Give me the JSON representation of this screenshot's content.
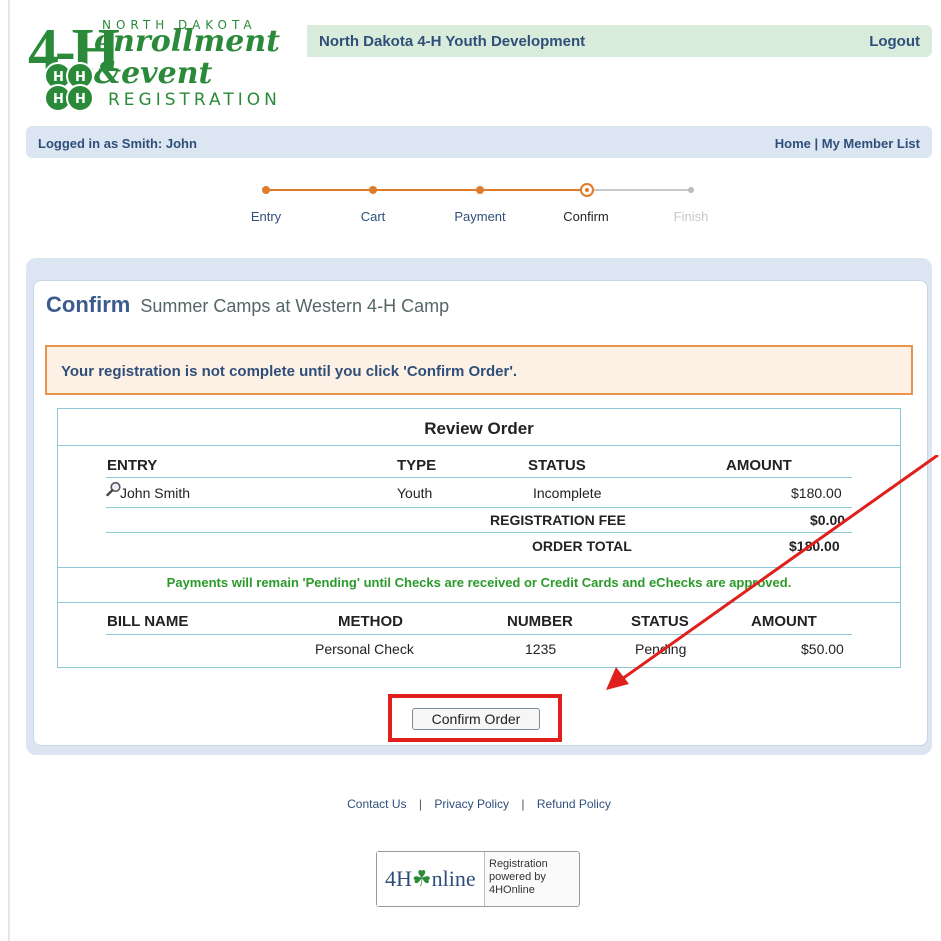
{
  "logo": {
    "big": "4-H",
    "state": "NORTH DAKOTA",
    "line1": "enrollment",
    "line2": "&event",
    "line3": "REGISTRATION"
  },
  "header": {
    "title": "North Dakota 4-H Youth Development",
    "logout": "Logout"
  },
  "userbar": {
    "logged_in": "Logged in as Smith: John",
    "home": "Home",
    "divider": "|",
    "member_list": "My Member List"
  },
  "steps": [
    {
      "label": "Entry",
      "state": "done"
    },
    {
      "label": "Cart",
      "state": "done"
    },
    {
      "label": "Payment",
      "state": "done"
    },
    {
      "label": "Confirm",
      "state": "current"
    },
    {
      "label": "Finish",
      "state": "pending"
    }
  ],
  "colors": {
    "step_done": "#e07b2a",
    "step_pending": "#bbbbbb",
    "accent_blue": "#2f4f7a",
    "highlight_red": "#e0201c",
    "notice_border": "#e8944a"
  },
  "main": {
    "heading": "Confirm",
    "subheading": "Summer Camps at Western 4-H Camp",
    "notice": "Your registration is not complete until you click 'Confirm Order'."
  },
  "review": {
    "title": "Review Order",
    "order_headers": [
      "ENTRY",
      "TYPE",
      "STATUS",
      "AMOUNT"
    ],
    "order_rows": [
      {
        "entry": "John Smith",
        "type": "Youth",
        "status": "Incomplete",
        "amount": "$180.00"
      }
    ],
    "fee_label": "REGISTRATION FEE",
    "fee_value": "$0.00",
    "total_label": "ORDER TOTAL",
    "total_value": "$180.00",
    "payments_note": "Payments will remain 'Pending' until Checks are received or Credit Cards and eChecks are approved.",
    "payment_headers": [
      "BILL NAME",
      "METHOD",
      "NUMBER",
      "STATUS",
      "AMOUNT"
    ],
    "payment_rows": [
      {
        "bill_name": "",
        "method": "Personal Check",
        "number": "1235",
        "status": "Pending",
        "amount": "$50.00"
      }
    ]
  },
  "confirm_button": "Confirm Order",
  "footer": {
    "contact": "Contact Us",
    "privacy": "Privacy Policy",
    "refund": "Refund Policy",
    "divider": "|",
    "badge_logo_a": "4H",
    "badge_logo_b": "nline",
    "badge_line1": "Registration",
    "badge_line2": "powered by",
    "badge_line3": "4HOnline"
  }
}
